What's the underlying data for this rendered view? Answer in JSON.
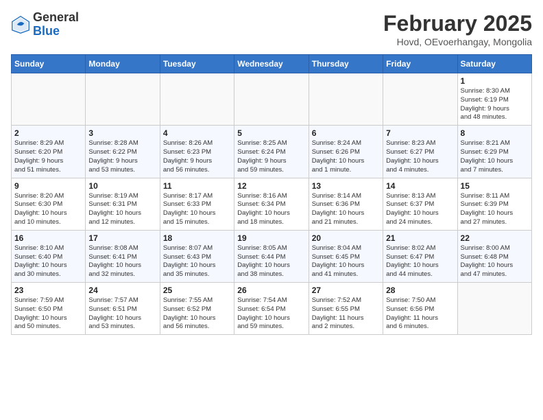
{
  "header": {
    "logo": {
      "general": "General",
      "blue": "Blue"
    },
    "title": "February 2025",
    "location": "Hovd, OEvoerhangay, Mongolia"
  },
  "calendar": {
    "days_of_week": [
      "Sunday",
      "Monday",
      "Tuesday",
      "Wednesday",
      "Thursday",
      "Friday",
      "Saturday"
    ],
    "weeks": [
      {
        "cells": [
          {
            "day": "",
            "info": ""
          },
          {
            "day": "",
            "info": ""
          },
          {
            "day": "",
            "info": ""
          },
          {
            "day": "",
            "info": ""
          },
          {
            "day": "",
            "info": ""
          },
          {
            "day": "",
            "info": ""
          },
          {
            "day": "1",
            "info": "Sunrise: 8:30 AM\nSunset: 6:19 PM\nDaylight: 9 hours\nand 48 minutes."
          }
        ]
      },
      {
        "cells": [
          {
            "day": "2",
            "info": "Sunrise: 8:29 AM\nSunset: 6:20 PM\nDaylight: 9 hours\nand 51 minutes."
          },
          {
            "day": "3",
            "info": "Sunrise: 8:28 AM\nSunset: 6:22 PM\nDaylight: 9 hours\nand 53 minutes."
          },
          {
            "day": "4",
            "info": "Sunrise: 8:26 AM\nSunset: 6:23 PM\nDaylight: 9 hours\nand 56 minutes."
          },
          {
            "day": "5",
            "info": "Sunrise: 8:25 AM\nSunset: 6:24 PM\nDaylight: 9 hours\nand 59 minutes."
          },
          {
            "day": "6",
            "info": "Sunrise: 8:24 AM\nSunset: 6:26 PM\nDaylight: 10 hours\nand 1 minute."
          },
          {
            "day": "7",
            "info": "Sunrise: 8:23 AM\nSunset: 6:27 PM\nDaylight: 10 hours\nand 4 minutes."
          },
          {
            "day": "8",
            "info": "Sunrise: 8:21 AM\nSunset: 6:29 PM\nDaylight: 10 hours\nand 7 minutes."
          }
        ]
      },
      {
        "cells": [
          {
            "day": "9",
            "info": "Sunrise: 8:20 AM\nSunset: 6:30 PM\nDaylight: 10 hours\nand 10 minutes."
          },
          {
            "day": "10",
            "info": "Sunrise: 8:19 AM\nSunset: 6:31 PM\nDaylight: 10 hours\nand 12 minutes."
          },
          {
            "day": "11",
            "info": "Sunrise: 8:17 AM\nSunset: 6:33 PM\nDaylight: 10 hours\nand 15 minutes."
          },
          {
            "day": "12",
            "info": "Sunrise: 8:16 AM\nSunset: 6:34 PM\nDaylight: 10 hours\nand 18 minutes."
          },
          {
            "day": "13",
            "info": "Sunrise: 8:14 AM\nSunset: 6:36 PM\nDaylight: 10 hours\nand 21 minutes."
          },
          {
            "day": "14",
            "info": "Sunrise: 8:13 AM\nSunset: 6:37 PM\nDaylight: 10 hours\nand 24 minutes."
          },
          {
            "day": "15",
            "info": "Sunrise: 8:11 AM\nSunset: 6:39 PM\nDaylight: 10 hours\nand 27 minutes."
          }
        ]
      },
      {
        "cells": [
          {
            "day": "16",
            "info": "Sunrise: 8:10 AM\nSunset: 6:40 PM\nDaylight: 10 hours\nand 30 minutes."
          },
          {
            "day": "17",
            "info": "Sunrise: 8:08 AM\nSunset: 6:41 PM\nDaylight: 10 hours\nand 32 minutes."
          },
          {
            "day": "18",
            "info": "Sunrise: 8:07 AM\nSunset: 6:43 PM\nDaylight: 10 hours\nand 35 minutes."
          },
          {
            "day": "19",
            "info": "Sunrise: 8:05 AM\nSunset: 6:44 PM\nDaylight: 10 hours\nand 38 minutes."
          },
          {
            "day": "20",
            "info": "Sunrise: 8:04 AM\nSunset: 6:45 PM\nDaylight: 10 hours\nand 41 minutes."
          },
          {
            "day": "21",
            "info": "Sunrise: 8:02 AM\nSunset: 6:47 PM\nDaylight: 10 hours\nand 44 minutes."
          },
          {
            "day": "22",
            "info": "Sunrise: 8:00 AM\nSunset: 6:48 PM\nDaylight: 10 hours\nand 47 minutes."
          }
        ]
      },
      {
        "cells": [
          {
            "day": "23",
            "info": "Sunrise: 7:59 AM\nSunset: 6:50 PM\nDaylight: 10 hours\nand 50 minutes."
          },
          {
            "day": "24",
            "info": "Sunrise: 7:57 AM\nSunset: 6:51 PM\nDaylight: 10 hours\nand 53 minutes."
          },
          {
            "day": "25",
            "info": "Sunrise: 7:55 AM\nSunset: 6:52 PM\nDaylight: 10 hours\nand 56 minutes."
          },
          {
            "day": "26",
            "info": "Sunrise: 7:54 AM\nSunset: 6:54 PM\nDaylight: 10 hours\nand 59 minutes."
          },
          {
            "day": "27",
            "info": "Sunrise: 7:52 AM\nSunset: 6:55 PM\nDaylight: 11 hours\nand 2 minutes."
          },
          {
            "day": "28",
            "info": "Sunrise: 7:50 AM\nSunset: 6:56 PM\nDaylight: 11 hours\nand 6 minutes."
          },
          {
            "day": "",
            "info": ""
          }
        ]
      }
    ]
  }
}
